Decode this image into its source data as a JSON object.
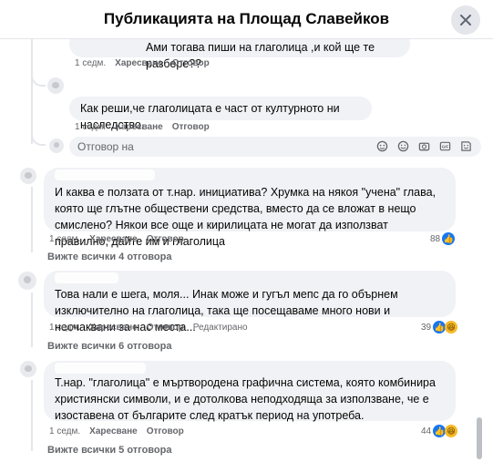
{
  "header": {
    "title": "Публикацията на Площад Славейков"
  },
  "replies": [
    {
      "text": "Ами тогава пиши на глаголица ,и кой ще те разбере??",
      "time": "1 седм.",
      "like": "Харесване",
      "reply": "Отговор"
    },
    {
      "text": "Как реши,че глаголицата е част от културното ни наследство.",
      "time": "1 седм.",
      "like": "Харесване",
      "reply": "Отговор"
    }
  ],
  "reply_box": {
    "placeholder": "Отговор на"
  },
  "comments": [
    {
      "text": "И каква е ползата от т.нар. инициатива? Хрумка на някоя \"учена\" глава, която ще глътне обществени средства, вместо да се вложат в нещо смислено? Някои все още и кирилицата не могат да използват правилно, дайте им и глаголица",
      "time": "1 седм.",
      "like": "Харесване",
      "reply": "Отговор",
      "edited": "",
      "reaction_count": "88",
      "view_all": "Вижте всички 4 отговора"
    },
    {
      "text": "Това нали е шега, моля... Инак може и гугъл мепс да го обърнем изключително на глаголица, така ще посещаваме много нови и неочаквани за нас места...",
      "time": "1 седм.",
      "like": "Харесване",
      "reply": "Отговор",
      "edited": "Редактирано",
      "reaction_count": "39",
      "view_all": "Вижте всички 6 отговора"
    },
    {
      "text": "Т.нар. \"глаголица\" е мъртвородена графична система, която комбинира християнски символи, и е дотолкова неподходяща за използване, че е изоставена от българите след кратък период на употреба.",
      "time": "1 седм.",
      "like": "Харесване",
      "reply": "Отговор",
      "edited": "",
      "reaction_count": "44",
      "view_all": "Вижте всички 5 отговора"
    }
  ],
  "colors": {
    "like_blue": "#1877f2",
    "haha_yellow": "#f7b928",
    "bubble_bg": "#f0f2f5",
    "meta_gray": "#65676b"
  }
}
